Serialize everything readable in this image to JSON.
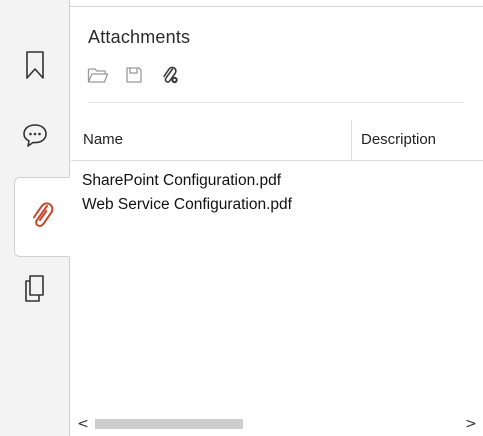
{
  "panel": {
    "title": "Attachments"
  },
  "toolbar": {
    "open_icon": "folder-open-icon",
    "save_icon": "save-disk-icon",
    "attach_icon": "paperclip-settings-icon"
  },
  "rail": {
    "items": [
      {
        "icon": "bookmark-icon",
        "active": false
      },
      {
        "icon": "comment-icon",
        "active": false
      },
      {
        "icon": "paperclip-icon",
        "active": true
      },
      {
        "icon": "pages-icon",
        "active": false
      }
    ],
    "accent_color": "#c8472e"
  },
  "table": {
    "columns": [
      "Name",
      "Description"
    ],
    "rows": [
      {
        "name": "SharePoint Configuration.pdf",
        "description": ""
      },
      {
        "name": "Web Service Configuration.pdf",
        "description": ""
      }
    ]
  },
  "scrollbar": {
    "left_arrow": "<",
    "right_arrow": ">"
  }
}
